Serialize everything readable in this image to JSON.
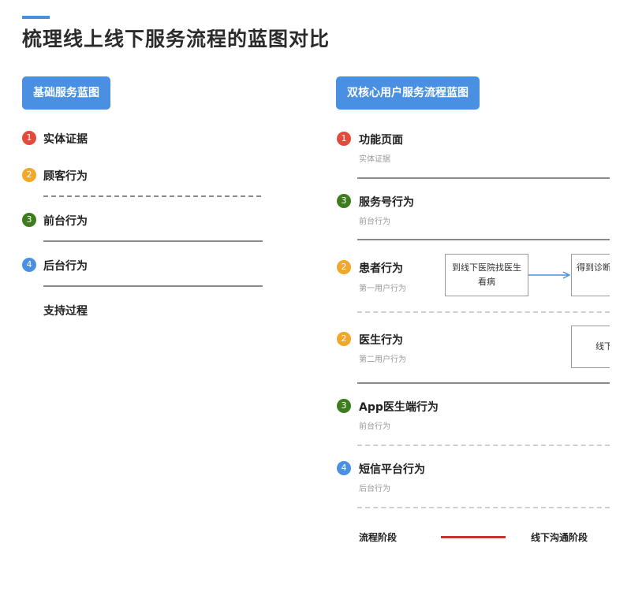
{
  "page_title": "梳理线上线下服务流程的蓝图对比",
  "colors": {
    "accent": "#4a90e2",
    "red": "#e24b3b",
    "orange": "#f1a829",
    "green": "#3e7d1e",
    "blue": "#4a90e2",
    "legend_line": "#c0392b"
  },
  "left": {
    "tag": "基础服务蓝图",
    "rows": [
      {
        "num": "1",
        "label": "实体证据"
      },
      {
        "num": "2",
        "label": "顾客行为"
      },
      {
        "num": "3",
        "label": "前台行为"
      },
      {
        "num": "4",
        "label": "后台行为"
      }
    ],
    "support": "支持过程"
  },
  "right": {
    "tag": "双核心用户服务流程蓝图",
    "rows": [
      {
        "num": "1",
        "label": "功能页面",
        "sub": "实体证据"
      },
      {
        "num": "3",
        "label": "服务号行为",
        "sub": "前台行为"
      },
      {
        "num": "2",
        "label": "患者行为",
        "sub": "第一用户行为"
      },
      {
        "num": "2",
        "label": "医生行为",
        "sub": "第二用户行为"
      },
      {
        "num": "3",
        "label": "App医生端行为",
        "sub": "前台行为"
      },
      {
        "num": "4",
        "label": "短信平台行为",
        "sub": "后台行为"
      }
    ],
    "boxes": {
      "patient_step1": "到线下医院找医生看病",
      "patient_step2": "得到诊断结果复诊",
      "doctor_step1": "线下"
    },
    "legend": {
      "left": "流程阶段",
      "right": "线下沟通阶段"
    }
  }
}
